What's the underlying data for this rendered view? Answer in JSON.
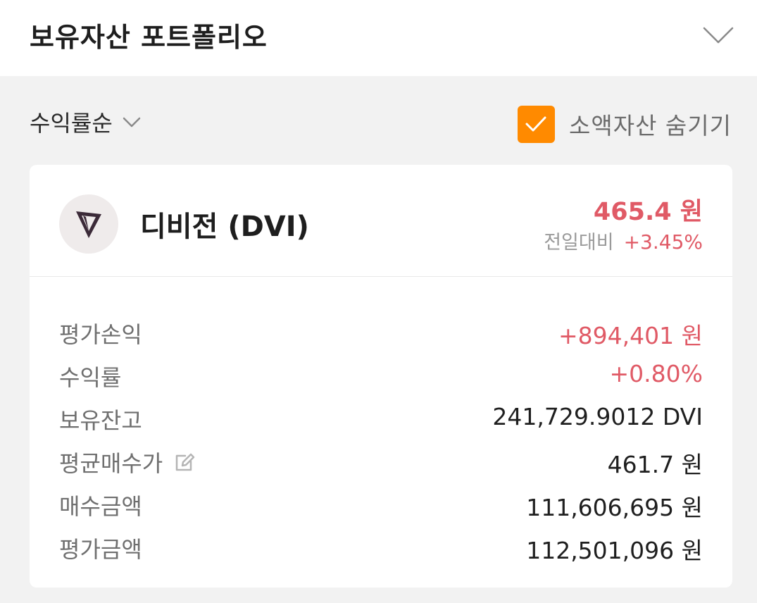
{
  "header": {
    "title": "보유자산 포트폴리오",
    "collapse_icon": "chevron-down-icon"
  },
  "controls": {
    "sort_label": "수익률순",
    "hide_small_label": "소액자산 숨기기",
    "hide_small_checked": true,
    "accent_color": "#ff8a00"
  },
  "asset": {
    "name": "디비전 (DVI)",
    "price": "465.4 원",
    "change_label": "전일대비",
    "change_value": "+3.45%",
    "up_color": "#e05a66",
    "stats": [
      {
        "label": "평가손익",
        "value": "+894,401 원",
        "highlight": true
      },
      {
        "label": "수익률",
        "value": "+0.80%",
        "highlight": true
      },
      {
        "label": "보유잔고",
        "value": "241,729.9012 DVI",
        "highlight": false
      },
      {
        "label": "평균매수가",
        "value": "461.7 원",
        "highlight": false,
        "edit_icon": "edit-icon"
      },
      {
        "label": "매수금액",
        "value": "111,606,695 원",
        "highlight": false
      },
      {
        "label": "평가금액",
        "value": "112,501,096 원",
        "highlight": false
      }
    ]
  }
}
